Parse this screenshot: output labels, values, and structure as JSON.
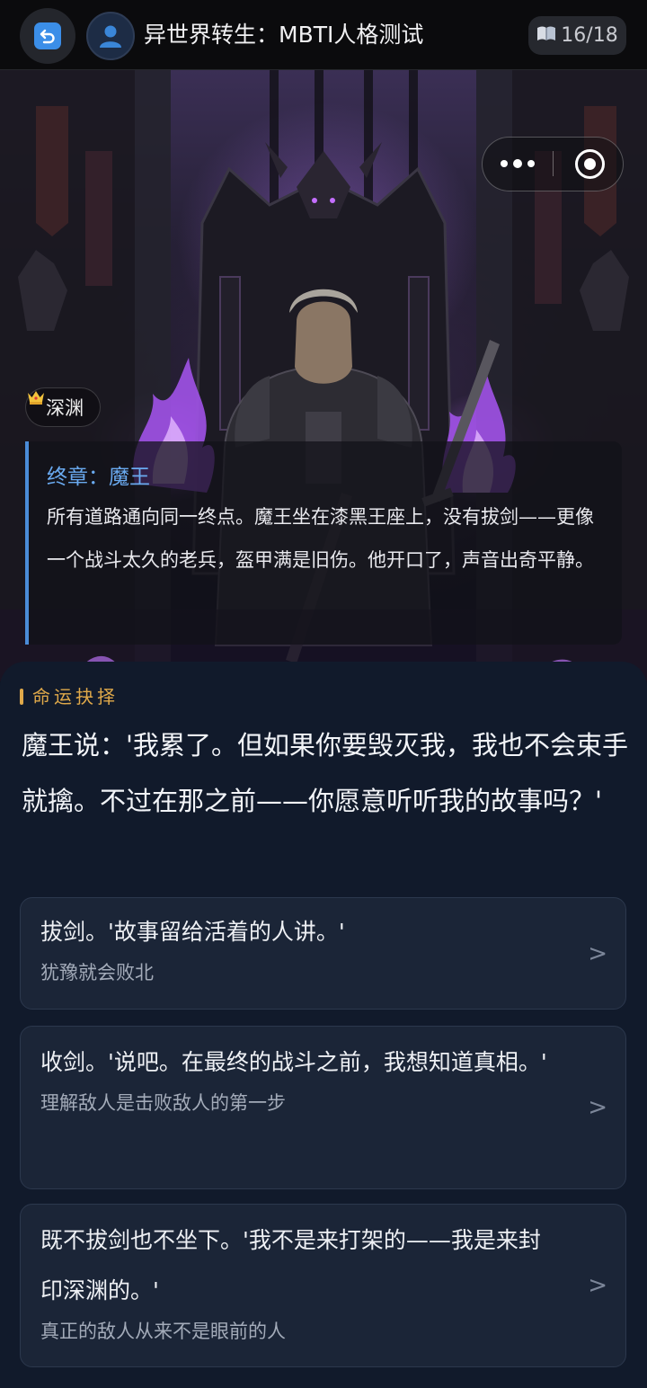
{
  "topbar": {
    "title": "异世界转生：MBTI人格测试",
    "progress_icon": "open-book-icon",
    "progress": "16/18"
  },
  "hero": {
    "realm_icon": "crown-icon",
    "realm": "深渊",
    "chapter_title": "终章：魔王",
    "chapter_text": "所有道路通向同一终点。魔王坐在漆黑王座上，没有拔剑——更像一个战斗太久的老兵，盔甲满是旧伤。他开口了，声音出奇平静。"
  },
  "panel": {
    "section_label": "命运抉择",
    "question": "魔王说：'我累了。但如果你要毁灭我，我也不会束手就擒。不过在那之前——你愿意听听我的故事吗？'",
    "options": [
      {
        "text": "拔剑。'故事留给活着的人讲。'",
        "hint": "犹豫就会败北"
      },
      {
        "text": "收剑。'说吧。在最终的战斗之前，我想知道真相。'",
        "hint": "理解敌人是击败敌人的第一步"
      },
      {
        "text": "既不拔剑也不坐下。'我不是来打架的——我是来封印深渊的。'",
        "hint": "真正的敌人从来不是眼前的人"
      }
    ],
    "chevron": ">"
  },
  "colors": {
    "accent_blue": "#4a8cd8",
    "gold": "#e0a94a",
    "panel_bg": "#111a2b",
    "flame": "#c46eff"
  }
}
